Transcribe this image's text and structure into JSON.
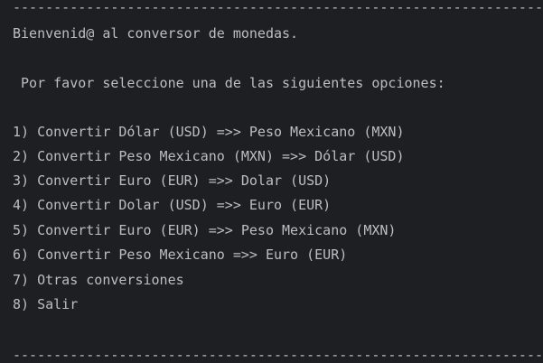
{
  "console": {
    "separator": "----------------------------------------------------------------------------------",
    "welcome": "Bienvenid@ al conversor de monedas.",
    "prompt": " Por favor seleccione una de las siguientes opciones:",
    "options": [
      "1) Convertir Dólar (USD) =>> Peso Mexicano (MXN)",
      "2) Convertir Peso Mexicano (MXN) =>> Dólar (USD)",
      "3) Convertir Euro (EUR) =>> Dolar (USD)",
      "4) Convertir Dolar (USD) =>> Euro (EUR)",
      "5) Convertir Euro (EUR) =>> Peso Mexicano (MXN)",
      "6) Convertir Peso Mexicano =>> Euro (EUR)",
      "7) Otras conversiones",
      "8) Salir"
    ]
  }
}
